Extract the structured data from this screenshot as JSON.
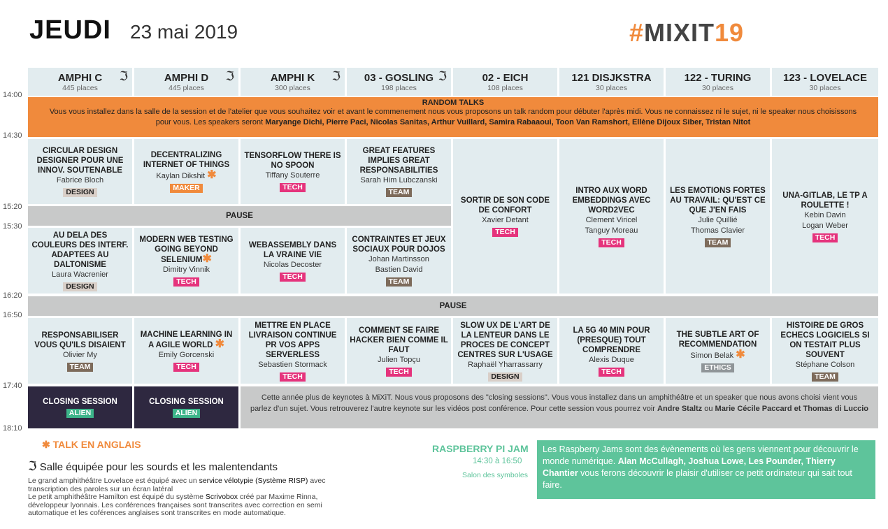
{
  "header": {
    "day": "JEUDI",
    "date": "23 mai 2019",
    "brand_hash": "#",
    "brand_name": "MIXIT",
    "brand_num": "19"
  },
  "times": [
    "14:00",
    "14:30",
    "15:20",
    "15:30",
    "16:20",
    "16:50",
    "17:40",
    "18:10"
  ],
  "rooms": [
    {
      "name": "AMPHI C",
      "places": "445 places",
      "hearing": true
    },
    {
      "name": "AMPHI D",
      "places": "445 places",
      "hearing": true
    },
    {
      "name": "AMPHI K",
      "places": "300 places",
      "hearing": true
    },
    {
      "name": "03 - GOSLING",
      "places": "198 places",
      "hearing": true
    },
    {
      "name": "02 - EICH",
      "places": "108 places",
      "hearing": false
    },
    {
      "name": "121 DISJKSTRA",
      "places": "30 places",
      "hearing": false
    },
    {
      "name": "122 - TURING",
      "places": "30 places",
      "hearing": false
    },
    {
      "name": "123 - LOVELACE",
      "places": "30 places",
      "hearing": false
    }
  ],
  "random_talks": {
    "title": "RANDOM TALKS",
    "desc1": "Vous vous installez dans la salle de la session et de l'atelier que vous souhaitez voir et avant le commenement nous vous proposons un talk random pour débuter l'après midi.  Vous ne connaissez ni le sujet, ni le speaker nous choisissons",
    "desc2": "pour vous. Les speakers seront ",
    "speakers": "Maryange Dichi, Pierre Paci, Nicolas Sanitas, Arthur Vuillard, Samira Rabaaoui, Toon Van Ramshort, Ellène Dijoux Siber, Tristan Nitot"
  },
  "slot1": [
    {
      "title": "CIRCULAR DESIGN DESIGNER POUR UNE INNOV. SOUTENABLE",
      "speakers": [
        "Fabrice Bloch"
      ],
      "tag": "DESIGN"
    },
    {
      "title": "DECENTRALIZING INTERNET OF THINGS",
      "speakers": [
        "Kaylan Dikshit"
      ],
      "tag": "MAKER",
      "star": true
    },
    {
      "title": "TENSORFLOW THERE IS NO SPOON",
      "speakers": [
        "Tiffany Souterre"
      ],
      "tag": "TECH"
    },
    {
      "title": "GREAT FEATURES IMPLIES GREAT RESPONSABILITIES",
      "speakers": [
        "Sarah Him Lubczanski"
      ],
      "tag": "TEAM"
    }
  ],
  "long_sessions": [
    {
      "title": "SORTIR DE SON CODE DE CONFORT",
      "speakers": [
        "Xavier Detant"
      ],
      "tag": "TECH"
    },
    {
      "title": "INTRO AUX WORD EMBEDDINGS AVEC WORD2VEC",
      "speakers": [
        "Clement Viricel",
        "Tanguy Moreau"
      ],
      "tag": "TECH"
    },
    {
      "title": "LES EMOTIONS FORTES AU TRAVAIL: QU'EST CE QUE J'EN FAIS",
      "speakers": [
        "Julie Quillié",
        "Thomas Clavier"
      ],
      "tag": "TEAM"
    },
    {
      "title": "UNA-GITLAB, LE TP A ROULETTE !",
      "speakers": [
        "Kebin Davin",
        "Logan Weber"
      ],
      "tag": "TECH"
    }
  ],
  "pause_label": "PAUSE",
  "slot2": [
    {
      "title": "AU DELA DES COULEURS DES INTERF. ADAPTEES AU DALTONISME",
      "speakers": [
        "Laura Wacrenier"
      ],
      "tag": "DESIGN"
    },
    {
      "title": "MODERN WEB TESTING GOING BEYOND SELENIUM",
      "speakers": [
        "Dimitry Vinnik"
      ],
      "tag": "TECH",
      "star": true
    },
    {
      "title": "WEBASSEMBLY DANS LA VRAINE VIE",
      "speakers": [
        "Nicolas Decoster"
      ],
      "tag": "TECH"
    },
    {
      "title": "CONTRAINTES ET JEUX SOCIAUX POUR  DOJOS",
      "speakers": [
        "Johan Martinsson",
        "Bastien David"
      ],
      "tag": "TEAM"
    }
  ],
  "slot3": [
    {
      "title": "RESPONSABILISER VOUS QU'ILS DISAIENT",
      "speakers": [
        "Olivier My"
      ],
      "tag": "TEAM"
    },
    {
      "title": "MACHINE LEARNING IN A AGILE WORLD",
      "speakers": [
        "Emily Gorcenski"
      ],
      "tag": "TECH",
      "star": true
    },
    {
      "title": "METTRE EN PLACE LIVRAISON CONTINUE PR VOS APPS SERVERLESS",
      "speakers": [
        "Sebastien Stormack"
      ],
      "tag": "TECH"
    },
    {
      "title": "COMMENT SE FAIRE HACKER BIEN COMME IL FAUT",
      "speakers": [
        "Julien Topçu"
      ],
      "tag": "TECH"
    },
    {
      "title": "SLOW UX DE L'ART DE LA LENTEUR DANS LE PROCES DE CONCEPT CENTRES SUR L'USAGE",
      "speakers": [
        "Raphaël Yharrassarry"
      ],
      "tag": "DESIGN"
    },
    {
      "title": "LA 5G 40 MIN POUR (PRESQUE) TOUT COMPRENDRE",
      "speakers": [
        "Alexis  Duque"
      ],
      "tag": "TECH"
    },
    {
      "title": "THE SUBTLE ART OF RECOMMENDATION",
      "speakers": [
        "Simon Belak"
      ],
      "tag": "ETHICS",
      "star": true
    },
    {
      "title": "HISTOIRE DE GROS ECHECS LOGICIELS SI ON TESTAIT PLUS SOUVENT",
      "speakers": [
        "Stéphane Colson"
      ],
      "tag": "TEAM"
    }
  ],
  "closing": [
    {
      "title": "CLOSING SESSION",
      "tag": "ALIEN"
    },
    {
      "title": "CLOSING SESSION",
      "tag": "ALIEN"
    }
  ],
  "keynote": {
    "text1": "Cette année plus de keynotes à MiXiT. Nous vous proposons des \"closing sessions\". Vous vous installez dans un amphithéâtre et un speaker que nous avons choisi vient vous",
    "text2": "parlez d'un sujet. Vous retrouverez l'autre keynote sur les vidéos post conférence. Pour cette session vous pourrez voir ",
    "speaker1": "Andre Staltz",
    "or": " ou ",
    "speaker2": "Marie Cécile Paccard et Thomas di Luccio"
  },
  "legend": {
    "english": "TALK EN ANGLAIS",
    "hearing": "Salle équipée pour les sourds et les malentendants",
    "l1a": "Le grand amphithéâtre Lovelace est équipé avec un ",
    "l1b": "service vélotypie (Système RISP)",
    "l1c": " avec",
    "l2": "transcription des paroles sur un écran latéral",
    "l3a": "Le petit amphithéâtre Hamilton est équipé du système ",
    "l3b": "Scrivobox",
    "l3c": " créé par Maxime Rinna,",
    "l4": "développeur lyonnais. Les conférences françaises sont transcrites avec correction en semi",
    "l5": "automatique et les coférences anglaises sont transcrites en mode automatique."
  },
  "jam": {
    "title": "RASPBERRY PI JAM",
    "time": "14:30 à 16:50",
    "place": "Salon des symboles",
    "t1": "Les Raspberry Jams sont des évènements où les gens viennent pour découvrir",
    "t2": " le monde numérique. ",
    "names": "Alan McCullagh, Joshua Lowe,  Les Pounder, Thierry Chantier",
    "t3": " vous ferons découvrir  le plaisir d'utiliser ce petit ordinateur qui sait tout faire."
  },
  "colors": {
    "orange": "#f08a3c",
    "tech": "#e5337c",
    "team": "#7d6b5b",
    "alien": "#3db58a",
    "jam": "#5ec49b"
  }
}
